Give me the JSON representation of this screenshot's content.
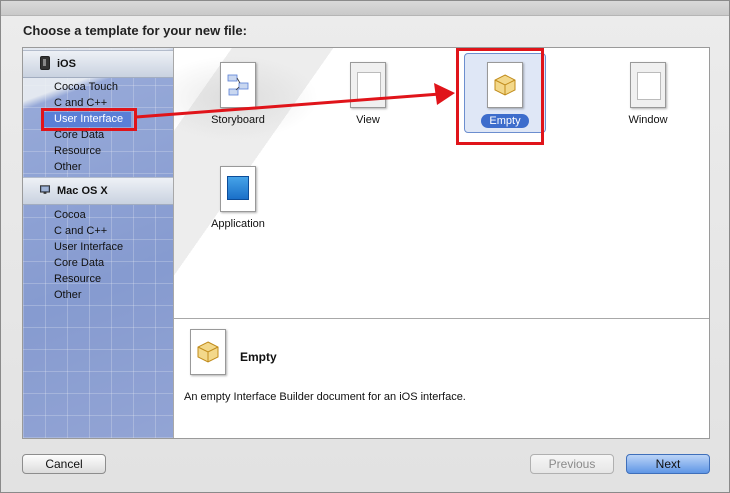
{
  "dialog": {
    "prompt": "Choose a template for your new file:"
  },
  "sidebar": {
    "sections": [
      {
        "title": "iOS",
        "icon": "iphone-icon",
        "items": [
          "Cocoa Touch",
          "C and C++",
          "User Interface",
          "Core Data",
          "Resource",
          "Other"
        ],
        "selected": "User Interface"
      },
      {
        "title": "Mac OS X",
        "icon": "mac-icon",
        "items": [
          "Cocoa",
          "C and C++",
          "User Interface",
          "Core Data",
          "Resource",
          "Other"
        ]
      }
    ]
  },
  "templates": [
    {
      "label": "Storyboard",
      "icon": "storyboard-document-icon"
    },
    {
      "label": "View",
      "icon": "view-document-icon"
    },
    {
      "label": "Empty",
      "icon": "empty-document-icon",
      "selected": true
    },
    {
      "label": "Window",
      "icon": "window-document-icon"
    },
    {
      "label": "Application",
      "icon": "application-document-icon"
    }
  ],
  "description": {
    "title": "Empty",
    "text": "An empty Interface Builder document for an iOS interface."
  },
  "buttons": {
    "cancel": "Cancel",
    "previous": "Previous",
    "next": "Next"
  },
  "annotation_color": "#e0141a",
  "accent_color": "#3d6dcc"
}
